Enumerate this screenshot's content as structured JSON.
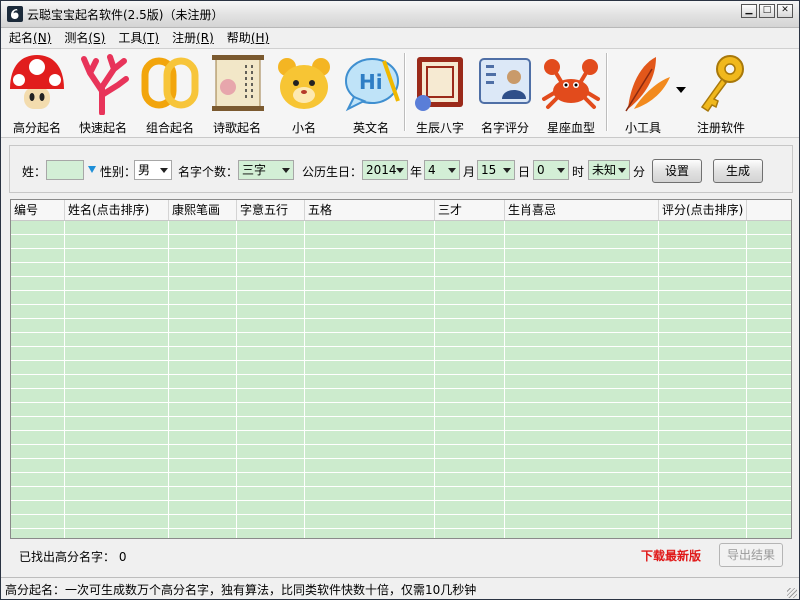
{
  "window": {
    "title": "云聪宝宝起名软件(2.5版)（未注册）"
  },
  "menu": [
    {
      "label": "起名",
      "key": "(N)"
    },
    {
      "label": "测名",
      "key": "(S)"
    },
    {
      "label": "工具",
      "key": "(T)"
    },
    {
      "label": "注册",
      "key": "(R)"
    },
    {
      "label": "帮助",
      "key": "(H)"
    }
  ],
  "toolbar": [
    {
      "label": "高分起名",
      "icon": "mushroom-icon"
    },
    {
      "label": "快速起名",
      "icon": "coral-icon"
    },
    {
      "label": "组合起名",
      "icon": "rings-icon"
    },
    {
      "label": "诗歌起名",
      "icon": "scroll-icon"
    },
    {
      "label": "小名",
      "icon": "bear-icon"
    },
    {
      "label": "英文名",
      "icon": "hi-bubble-icon"
    },
    {
      "label": "生辰八字",
      "icon": "calendar-icon"
    },
    {
      "label": "名字评分",
      "icon": "id-card-icon"
    },
    {
      "label": "星座血型",
      "icon": "crab-icon"
    },
    {
      "label": "小工具",
      "icon": "feather-icon"
    },
    {
      "label": "注册软件",
      "icon": "key-icon"
    }
  ],
  "form": {
    "surname_label": "姓：",
    "surname_value": "",
    "gender_label": "性别：",
    "gender_value": "男",
    "count_label": "名字个数：",
    "count_value": "三字",
    "birthday_label": "公历生日：",
    "year_value": "2014",
    "year_unit": "年",
    "month_value": "4",
    "month_unit": "月",
    "day_value": "15",
    "day_unit": "日",
    "hour_value": "0",
    "hour_unit": "时",
    "minute_value": "未知",
    "minute_unit": "分",
    "settings_button": "设置",
    "generate_button": "生成"
  },
  "table": {
    "columns": [
      "编号",
      "姓名(点击排序)",
      "康熙笔画",
      "字意五行",
      "五格",
      "三才",
      "生肖喜忌",
      "评分(点击排序)"
    ],
    "rows": []
  },
  "footer": {
    "found_label": "已找出高分名字：",
    "found_count": "0",
    "download_link": "下载最新版",
    "export_button": "导出结果"
  },
  "status": {
    "text": "高分起名：一次可生成数万个高分名字，独有算法，比同类软件快数十倍，仅需10几秒钟"
  }
}
